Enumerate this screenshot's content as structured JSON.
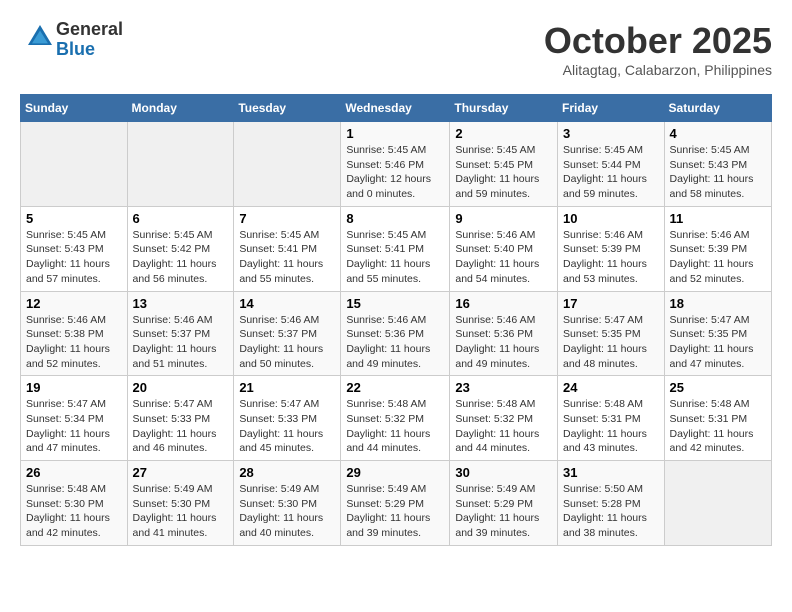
{
  "header": {
    "logo_line1": "General",
    "logo_line2": "Blue",
    "month": "October 2025",
    "location": "Alitagtag, Calabarzon, Philippines"
  },
  "weekdays": [
    "Sunday",
    "Monday",
    "Tuesday",
    "Wednesday",
    "Thursday",
    "Friday",
    "Saturday"
  ],
  "weeks": [
    [
      {
        "day": "",
        "info": ""
      },
      {
        "day": "",
        "info": ""
      },
      {
        "day": "",
        "info": ""
      },
      {
        "day": "1",
        "info": "Sunrise: 5:45 AM\nSunset: 5:46 PM\nDaylight: 12 hours\nand 0 minutes."
      },
      {
        "day": "2",
        "info": "Sunrise: 5:45 AM\nSunset: 5:45 PM\nDaylight: 11 hours\nand 59 minutes."
      },
      {
        "day": "3",
        "info": "Sunrise: 5:45 AM\nSunset: 5:44 PM\nDaylight: 11 hours\nand 59 minutes."
      },
      {
        "day": "4",
        "info": "Sunrise: 5:45 AM\nSunset: 5:43 PM\nDaylight: 11 hours\nand 58 minutes."
      }
    ],
    [
      {
        "day": "5",
        "info": "Sunrise: 5:45 AM\nSunset: 5:43 PM\nDaylight: 11 hours\nand 57 minutes."
      },
      {
        "day": "6",
        "info": "Sunrise: 5:45 AM\nSunset: 5:42 PM\nDaylight: 11 hours\nand 56 minutes."
      },
      {
        "day": "7",
        "info": "Sunrise: 5:45 AM\nSunset: 5:41 PM\nDaylight: 11 hours\nand 55 minutes."
      },
      {
        "day": "8",
        "info": "Sunrise: 5:45 AM\nSunset: 5:41 PM\nDaylight: 11 hours\nand 55 minutes."
      },
      {
        "day": "9",
        "info": "Sunrise: 5:46 AM\nSunset: 5:40 PM\nDaylight: 11 hours\nand 54 minutes."
      },
      {
        "day": "10",
        "info": "Sunrise: 5:46 AM\nSunset: 5:39 PM\nDaylight: 11 hours\nand 53 minutes."
      },
      {
        "day": "11",
        "info": "Sunrise: 5:46 AM\nSunset: 5:39 PM\nDaylight: 11 hours\nand 52 minutes."
      }
    ],
    [
      {
        "day": "12",
        "info": "Sunrise: 5:46 AM\nSunset: 5:38 PM\nDaylight: 11 hours\nand 52 minutes."
      },
      {
        "day": "13",
        "info": "Sunrise: 5:46 AM\nSunset: 5:37 PM\nDaylight: 11 hours\nand 51 minutes."
      },
      {
        "day": "14",
        "info": "Sunrise: 5:46 AM\nSunset: 5:37 PM\nDaylight: 11 hours\nand 50 minutes."
      },
      {
        "day": "15",
        "info": "Sunrise: 5:46 AM\nSunset: 5:36 PM\nDaylight: 11 hours\nand 49 minutes."
      },
      {
        "day": "16",
        "info": "Sunrise: 5:46 AM\nSunset: 5:36 PM\nDaylight: 11 hours\nand 49 minutes."
      },
      {
        "day": "17",
        "info": "Sunrise: 5:47 AM\nSunset: 5:35 PM\nDaylight: 11 hours\nand 48 minutes."
      },
      {
        "day": "18",
        "info": "Sunrise: 5:47 AM\nSunset: 5:35 PM\nDaylight: 11 hours\nand 47 minutes."
      }
    ],
    [
      {
        "day": "19",
        "info": "Sunrise: 5:47 AM\nSunset: 5:34 PM\nDaylight: 11 hours\nand 47 minutes."
      },
      {
        "day": "20",
        "info": "Sunrise: 5:47 AM\nSunset: 5:33 PM\nDaylight: 11 hours\nand 46 minutes."
      },
      {
        "day": "21",
        "info": "Sunrise: 5:47 AM\nSunset: 5:33 PM\nDaylight: 11 hours\nand 45 minutes."
      },
      {
        "day": "22",
        "info": "Sunrise: 5:48 AM\nSunset: 5:32 PM\nDaylight: 11 hours\nand 44 minutes."
      },
      {
        "day": "23",
        "info": "Sunrise: 5:48 AM\nSunset: 5:32 PM\nDaylight: 11 hours\nand 44 minutes."
      },
      {
        "day": "24",
        "info": "Sunrise: 5:48 AM\nSunset: 5:31 PM\nDaylight: 11 hours\nand 43 minutes."
      },
      {
        "day": "25",
        "info": "Sunrise: 5:48 AM\nSunset: 5:31 PM\nDaylight: 11 hours\nand 42 minutes."
      }
    ],
    [
      {
        "day": "26",
        "info": "Sunrise: 5:48 AM\nSunset: 5:30 PM\nDaylight: 11 hours\nand 42 minutes."
      },
      {
        "day": "27",
        "info": "Sunrise: 5:49 AM\nSunset: 5:30 PM\nDaylight: 11 hours\nand 41 minutes."
      },
      {
        "day": "28",
        "info": "Sunrise: 5:49 AM\nSunset: 5:30 PM\nDaylight: 11 hours\nand 40 minutes."
      },
      {
        "day": "29",
        "info": "Sunrise: 5:49 AM\nSunset: 5:29 PM\nDaylight: 11 hours\nand 39 minutes."
      },
      {
        "day": "30",
        "info": "Sunrise: 5:49 AM\nSunset: 5:29 PM\nDaylight: 11 hours\nand 39 minutes."
      },
      {
        "day": "31",
        "info": "Sunrise: 5:50 AM\nSunset: 5:28 PM\nDaylight: 11 hours\nand 38 minutes."
      },
      {
        "day": "",
        "info": ""
      }
    ]
  ]
}
